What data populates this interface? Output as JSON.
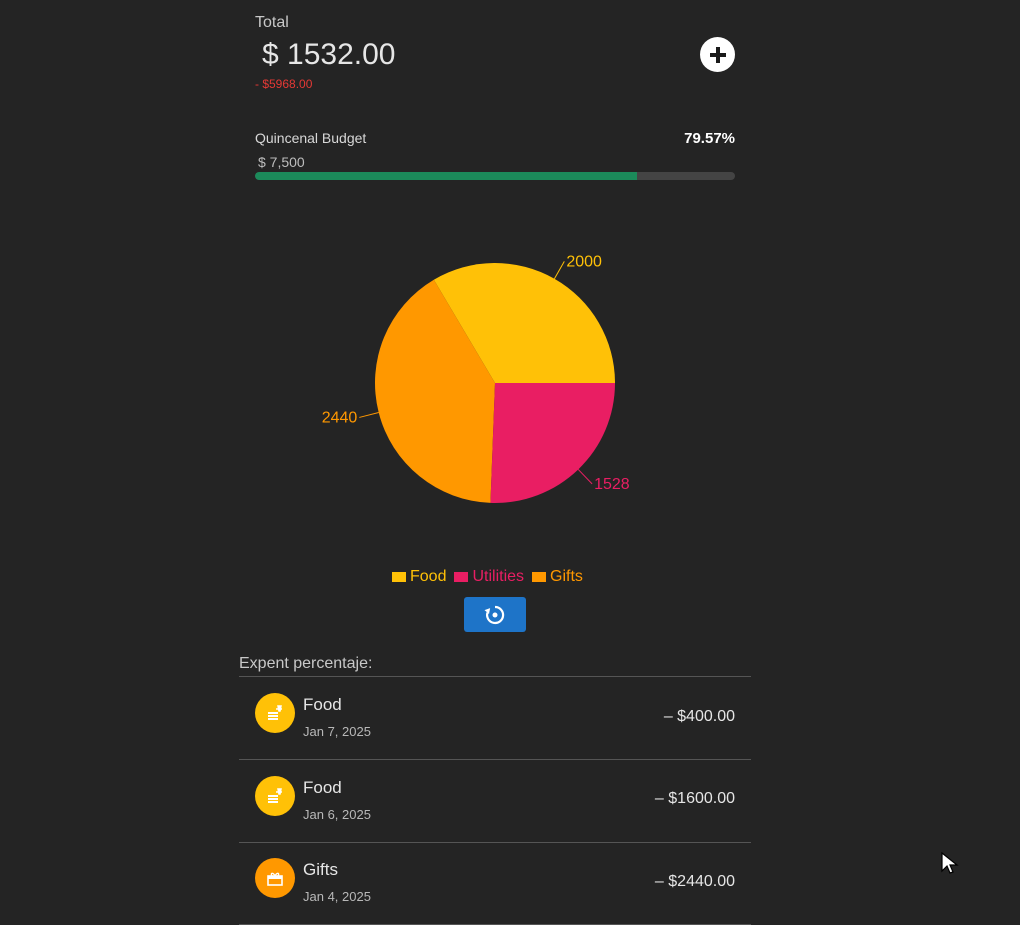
{
  "header": {
    "total_label": "Total",
    "total_amount": "$ 1532.00",
    "total_difference": "- $5968.00",
    "add_icon": "plus-icon"
  },
  "budget": {
    "label": "Quincenal Budget",
    "amount": "$ 7,500",
    "percentage_text": "79.57%",
    "progress_fraction": 0.7957,
    "bar_color": "#1b8a5a"
  },
  "chart_data": {
    "type": "pie",
    "slices": [
      {
        "name": "Food",
        "value": 2000,
        "color": "#ffc107"
      },
      {
        "name": "Gifts",
        "value": 2440,
        "color": "#ff9800"
      },
      {
        "name": "Utilities",
        "value": 1528,
        "color": "#e91e63"
      }
    ],
    "legend": [
      "Food",
      "Utilities",
      "Gifts"
    ],
    "legend_placement": "bottom-center"
  },
  "reset_icon": "reset-icon",
  "expenses": {
    "title": "Expent percentaje:",
    "items": [
      {
        "name": "Food",
        "date": "Jan 7, 2025",
        "amount": "– $400.00",
        "icon": "fastfood-icon",
        "color": "#ffc107"
      },
      {
        "name": "Food",
        "date": "Jan 6, 2025",
        "amount": "– $1600.00",
        "icon": "fastfood-icon",
        "color": "#ffc107"
      },
      {
        "name": "Gifts",
        "date": "Jan 4, 2025",
        "amount": "– $2440.00",
        "icon": "gift-icon",
        "color": "#ff9800"
      }
    ]
  }
}
